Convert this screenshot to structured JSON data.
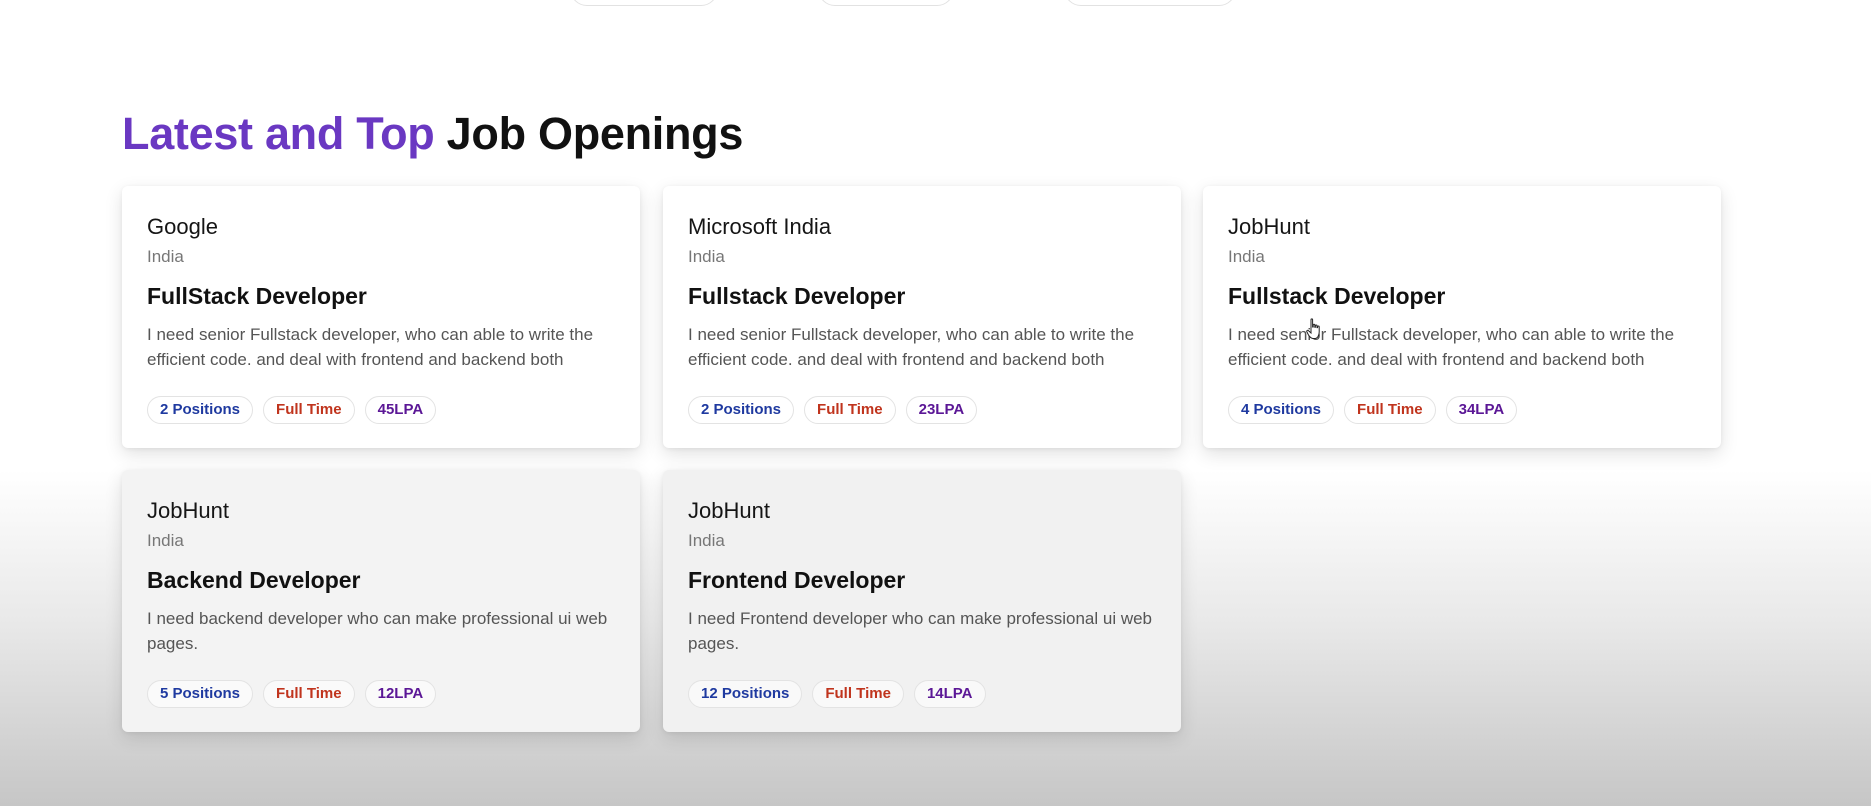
{
  "heading": {
    "accent": "Latest and Top",
    "rest": " Job Openings"
  },
  "jobs": [
    {
      "company": "Google",
      "location": "India",
      "title": "FullStack Developer",
      "description": "I need senior Fullstack developer, who can able to write the efficient code. and deal with frontend and backend both",
      "positions": "2 Positions",
      "type": "Full Time",
      "salary": "45LPA"
    },
    {
      "company": "Microsoft India",
      "location": "India",
      "title": "Fullstack Developer",
      "description": "I need senior Fullstack developer, who can able to write the efficient code. and deal with frontend and backend both",
      "positions": "2 Positions",
      "type": "Full Time",
      "salary": "23LPA"
    },
    {
      "company": "JobHunt",
      "location": "India",
      "title": "Fullstack Developer",
      "description": "I need senior Fullstack developer, who can able to write the efficient code. and deal with frontend and backend both",
      "positions": "4 Positions",
      "type": "Full Time",
      "salary": "34LPA"
    },
    {
      "company": "JobHunt",
      "location": "India",
      "title": "Backend Developer",
      "description": "I need backend developer who can make professional ui web pages.",
      "positions": "5 Positions",
      "type": "Full Time",
      "salary": "12LPA"
    },
    {
      "company": "JobHunt",
      "location": "India",
      "title": "Frontend Developer",
      "description": "I need Frontend developer who can make professional ui web pages.",
      "positions": "12 Positions",
      "type": "Full Time",
      "salary": "14LPA"
    }
  ],
  "colors": {
    "accent": "#6a38c2",
    "positions_badge": "#1f3aa0",
    "type_badge": "#c0341d",
    "salary_badge": "#5b1796"
  },
  "icons": {
    "cursor": "hand-pointer-icon"
  }
}
